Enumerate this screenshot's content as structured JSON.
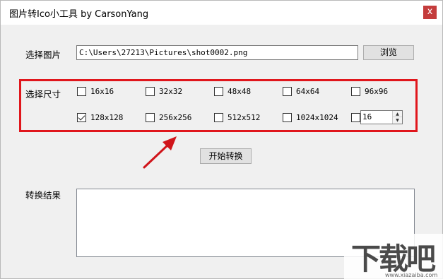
{
  "window": {
    "title": "图片转Ico小工具 by CarsonYang",
    "close_glyph": "x"
  },
  "select_image": {
    "label": "选择图片",
    "path_value": "C:\\Users\\27213\\Pictures\\shot0002.png",
    "browse_label": "浏览"
  },
  "select_size": {
    "label": "选择尺寸",
    "options": [
      {
        "label": "16x16",
        "checked": false
      },
      {
        "label": "32x32",
        "checked": false
      },
      {
        "label": "48x48",
        "checked": false
      },
      {
        "label": "64x64",
        "checked": false
      },
      {
        "label": "96x96",
        "checked": false
      },
      {
        "label": "128x128",
        "checked": true
      },
      {
        "label": "256x256",
        "checked": false
      },
      {
        "label": "512x512",
        "checked": false
      },
      {
        "label": "1024x1024",
        "checked": false
      }
    ],
    "custom": {
      "checked": false,
      "value": "16"
    }
  },
  "actions": {
    "start_label": "开始转换"
  },
  "result": {
    "label": "转换结果",
    "text": ""
  },
  "watermark": {
    "text": "下载吧",
    "sub": "www.xiazaiba.com"
  },
  "colors": {
    "highlight_border": "#e0161c",
    "arrow": "#d0141a",
    "close_button": "#c43c3c"
  }
}
